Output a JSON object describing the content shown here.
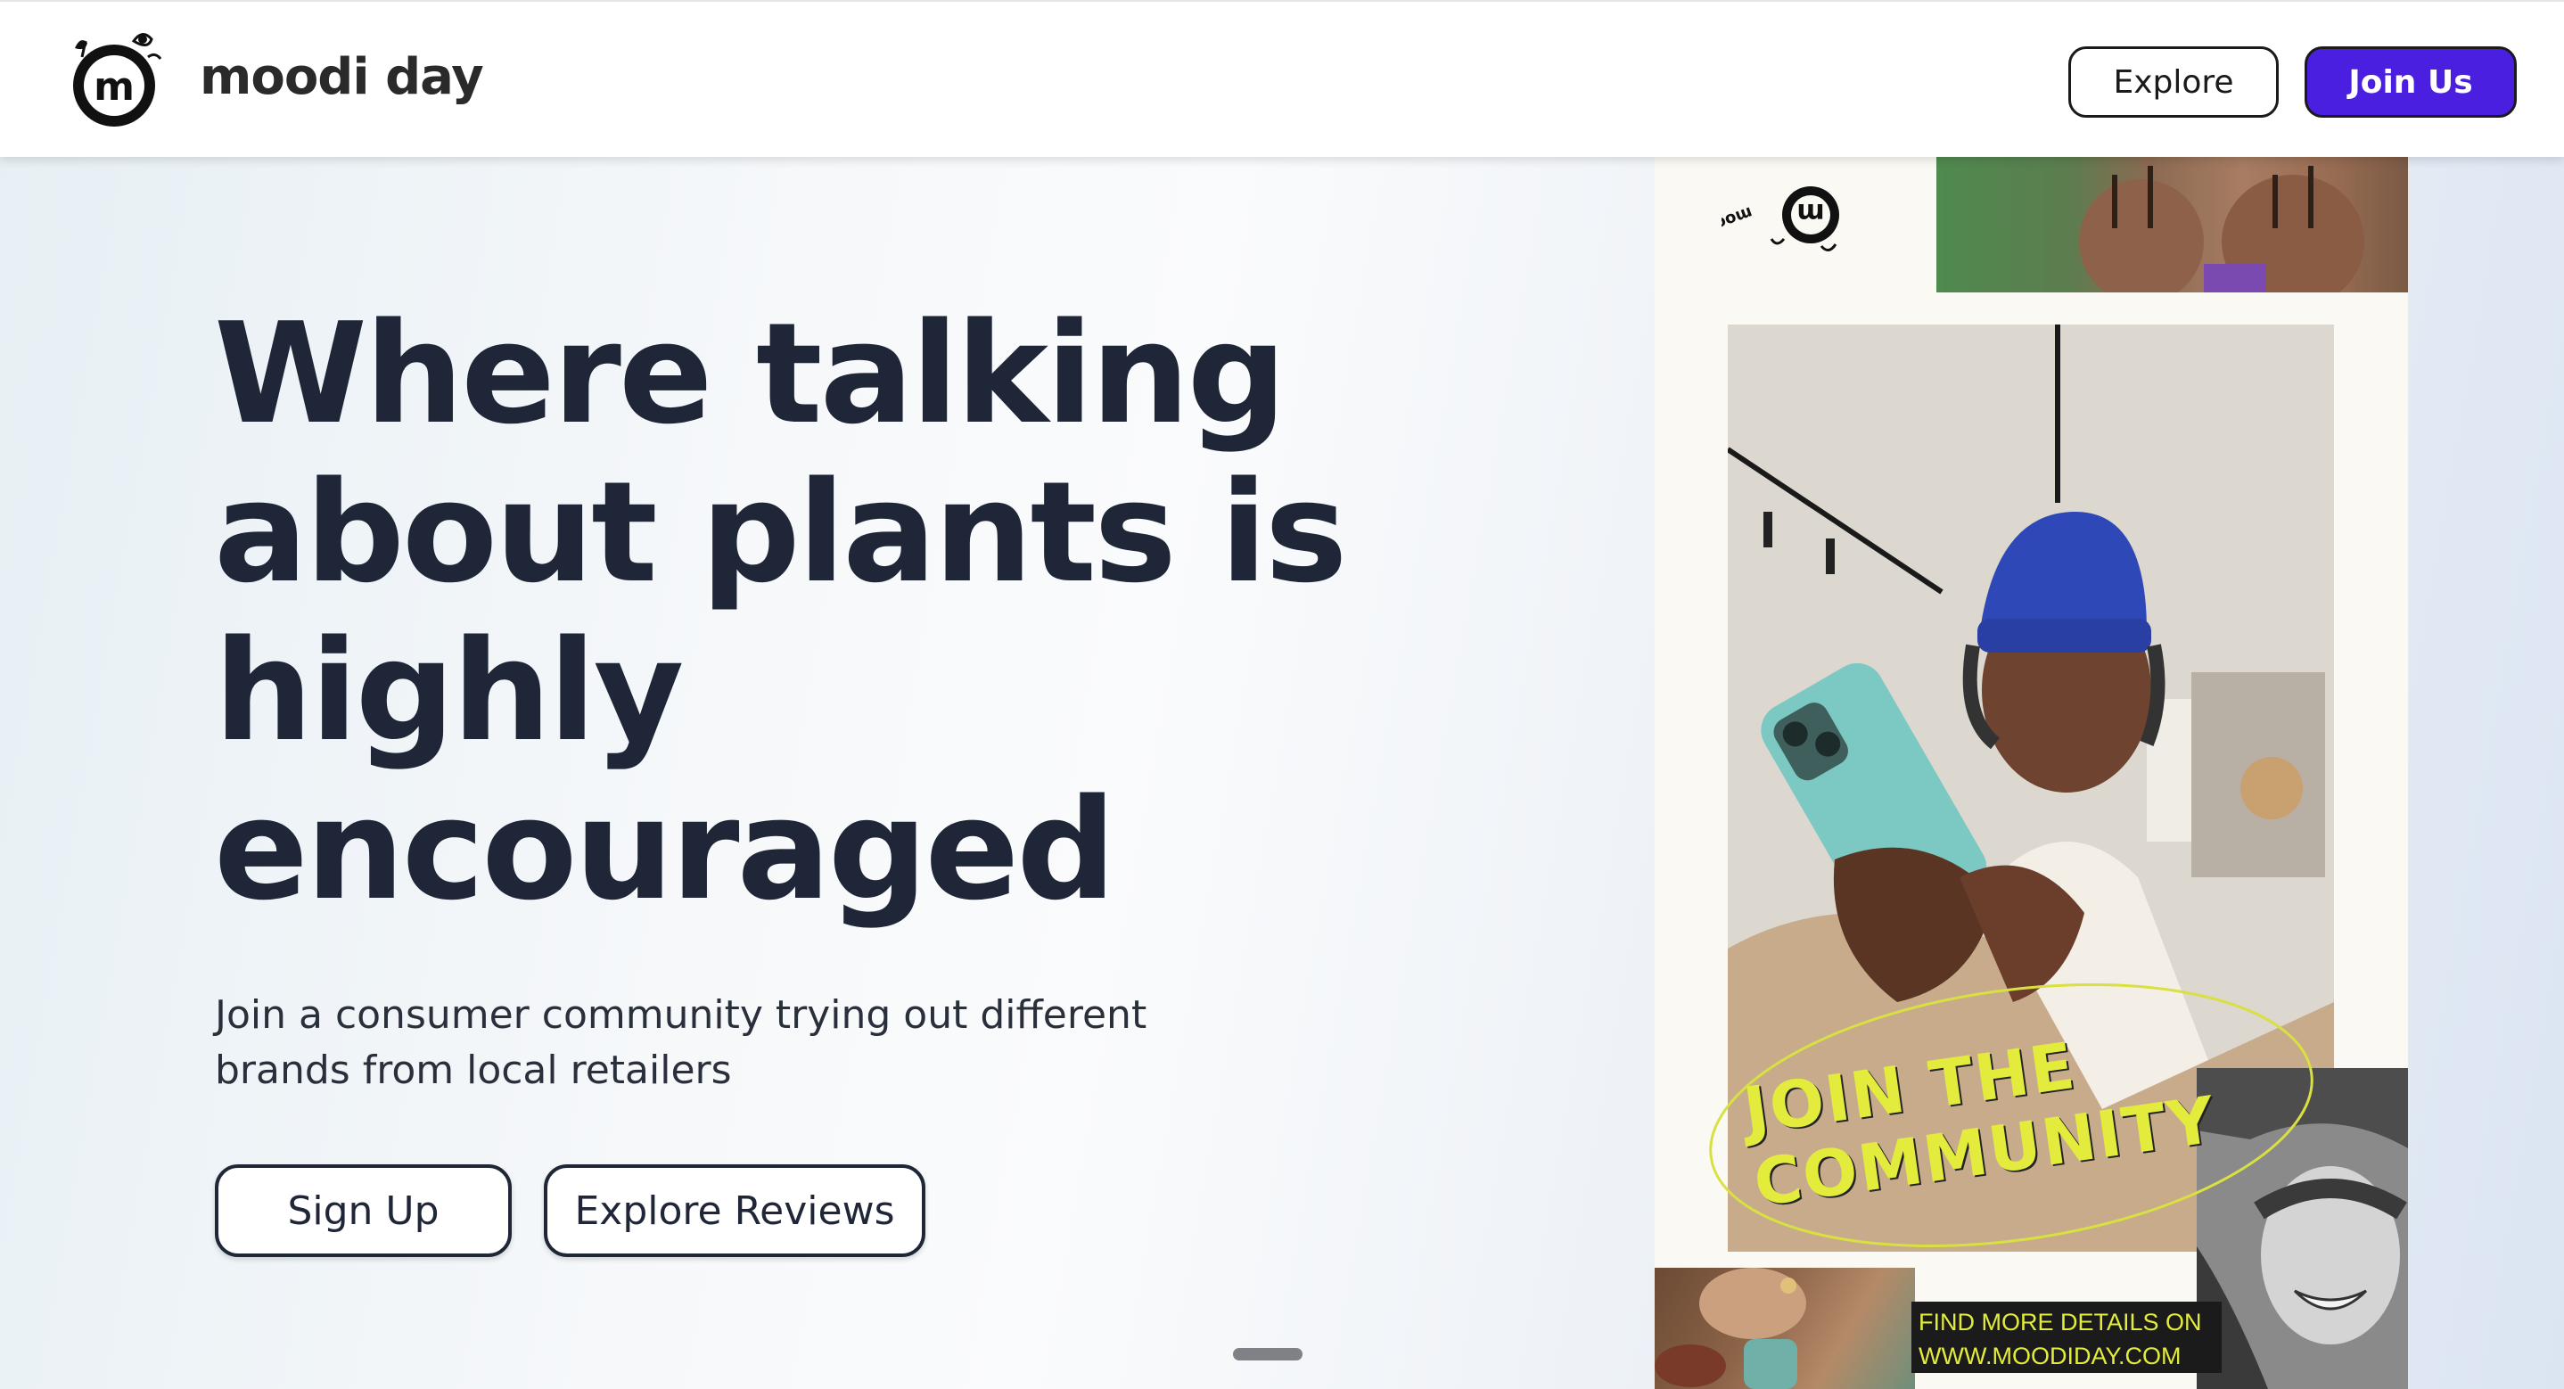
{
  "header": {
    "brand_name": "moodi day",
    "logo_letter": "m",
    "nav": {
      "explore_label": "Explore",
      "join_label": "Join Us"
    }
  },
  "hero": {
    "title": "Where talking about plants is highly encouraged",
    "subtitle": "Join a consumer community trying out different brands from local retailers",
    "signup_label": "Sign Up",
    "explore_reviews_label": "Explore Reviews"
  },
  "poster": {
    "logo_text": "moodi day",
    "logo_letter": "m",
    "tagline": "JOIN THE\nCOMMUNITY",
    "details_line1": "FIND MORE DETAILS ON",
    "details_line2": "WWW.MOODIDAY.COM"
  },
  "colors": {
    "primary": "#4b1fe0",
    "text_dark": "#1e2638",
    "poster_accent": "#e3ec3c",
    "poster_bg": "#fbf9f3"
  }
}
